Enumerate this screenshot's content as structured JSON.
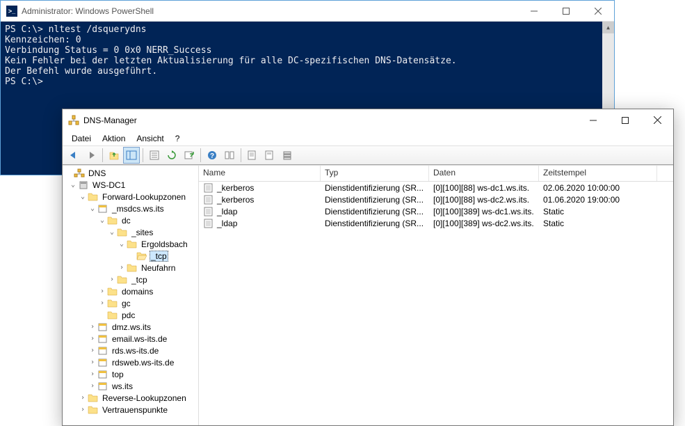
{
  "powershell": {
    "title": "Administrator: Windows PowerShell",
    "lines": "PS C:\\> nltest /dsquerydns\nKennzeichen: 0\nVerbindung Status = 0 0x0 NERR_Success\nKein Fehler bei der letzten Aktualisierung für alle DC-spezifischen DNS-Datensätze.\nDer Befehl wurde ausgeführt.\nPS C:\\>"
  },
  "dns": {
    "title": "DNS-Manager",
    "menu": {
      "datei": "Datei",
      "aktion": "Aktion",
      "ansicht": "Ansicht",
      "help": "?"
    },
    "headers": {
      "name": "Name",
      "typ": "Typ",
      "daten": "Daten",
      "zeit": "Zeitstempel"
    },
    "tree": {
      "root": "DNS",
      "server": "WS-DC1",
      "fwd": "Forward-Lookupzonen",
      "msdcs": "_msdcs.ws.its",
      "dc": "dc",
      "sites": "_sites",
      "ergold": "Ergoldsbach",
      "tcp_sel": "_tcp",
      "neufahrn": "Neufahrn",
      "tcp2": "_tcp",
      "domains": "domains",
      "gc": "gc",
      "pdc": "pdc",
      "dmz": "dmz.ws.its",
      "email": "email.ws-its.de",
      "rds": "rds.ws-its.de",
      "rdsweb": "rdsweb.ws-its.de",
      "top": "top",
      "wsits": "ws.its",
      "rev": "Reverse-Lookupzonen",
      "trust": "Vertrauenspunkte"
    },
    "records": [
      {
        "name": "_kerberos",
        "typ": "Dienstidentifizierung (SR...",
        "daten": "[0][100][88] ws-dc1.ws.its.",
        "zeit": "02.06.2020 10:00:00"
      },
      {
        "name": "_kerberos",
        "typ": "Dienstidentifizierung (SR...",
        "daten": "[0][100][88] ws-dc2.ws.its.",
        "zeit": "01.06.2020 19:00:00"
      },
      {
        "name": "_ldap",
        "typ": "Dienstidentifizierung (SR...",
        "daten": "[0][100][389] ws-dc1.ws.its.",
        "zeit": "Static"
      },
      {
        "name": "_ldap",
        "typ": "Dienstidentifizierung (SR...",
        "daten": "[0][100][389] ws-dc2.ws.its.",
        "zeit": "Static"
      }
    ]
  }
}
